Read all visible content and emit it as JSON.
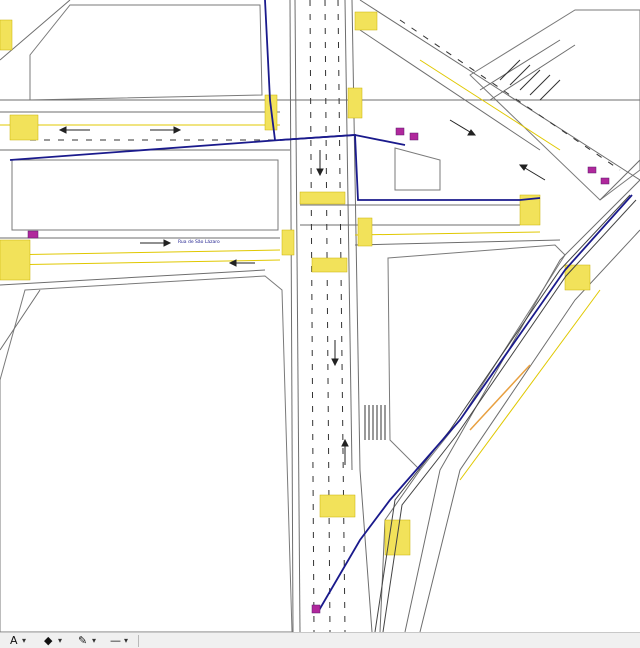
{
  "drawing": {
    "street_label": "Rua de São Lázaro",
    "colors": {
      "background": "#ffffff",
      "linework": "#6e6e6e",
      "marking": "#e0c800",
      "crossing": "#f2e25a",
      "route": "#1a1a8c",
      "accent_route": "#e8a040",
      "symbol": "#b0289c"
    }
  },
  "toolbar": {
    "items": [
      {
        "icon": "text-tool-icon",
        "glyph": "A"
      },
      {
        "icon": "fill-color-icon",
        "glyph": "◆"
      },
      {
        "icon": "line-color-icon",
        "glyph": "✎"
      },
      {
        "icon": "line-style-icon",
        "glyph": "—"
      }
    ],
    "dropdown_glyph": "▾"
  }
}
